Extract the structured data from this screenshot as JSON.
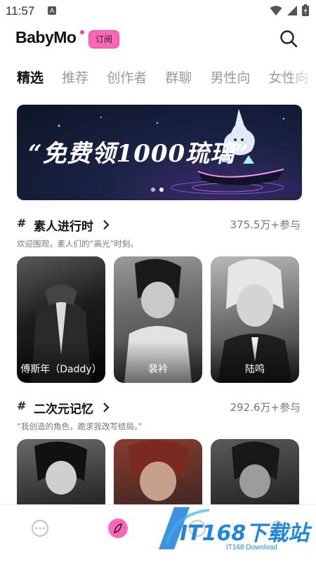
{
  "status_bar": {
    "time": "11:57",
    "notif_letter": "A"
  },
  "header": {
    "logo": "BabyMo",
    "subscribe_label": "订阅",
    "search_icon": "search-icon"
  },
  "tabs": [
    {
      "label": "精选",
      "active": true
    },
    {
      "label": "推荐",
      "active": false
    },
    {
      "label": "创作者",
      "active": false
    },
    {
      "label": "群聊",
      "active": false
    },
    {
      "label": "男性向",
      "active": false
    },
    {
      "label": "女性向",
      "active": false
    }
  ],
  "banner": {
    "title": "“免费领1000琉璃”",
    "dot_count": 2,
    "active_dot": 1
  },
  "sections": [
    {
      "title": "素人进行时",
      "count": "375.5万+参与",
      "desc": "欢迎围观，素人们的“高光”时刻。",
      "cards": [
        {
          "name": "傅斯年（Daddy）"
        },
        {
          "name": "裴衿"
        },
        {
          "name": "陆鸣"
        }
      ]
    },
    {
      "title": "二次元记忆",
      "count": "292.6万+参与",
      "desc": "“我创造的角色，跪求我改写结局。”",
      "cards": [
        {
          "name": ""
        },
        {
          "name": ""
        },
        {
          "name": ""
        }
      ]
    }
  ],
  "bottom_nav": {
    "items": [
      "chat-icon",
      "explore-icon",
      "create-icon",
      "profile-icon"
    ],
    "active": "explore-icon"
  },
  "watermark": {
    "brand": "IT168下载站",
    "sub": "IT168 Download"
  },
  "colors": {
    "accent": "#ff66b8",
    "accent_border": "#ff3fa4",
    "muted_text": "#9a9a9a"
  }
}
